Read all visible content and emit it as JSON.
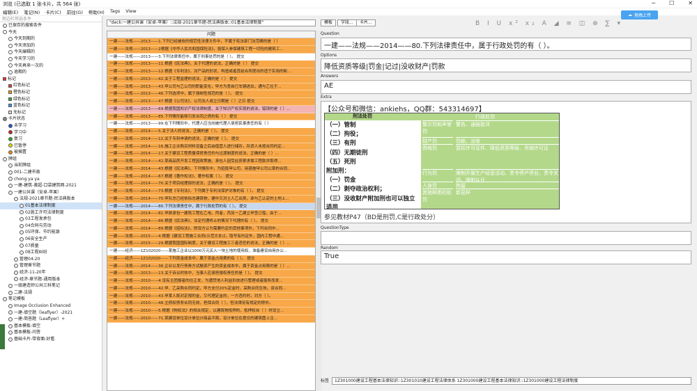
{
  "window": {
    "title": "浏览 (已选取 1 张卡片，共 564 张)",
    "controls": [
      "─",
      "☐",
      "✕"
    ]
  },
  "menu": [
    "编辑(E)",
    "笔记(N)",
    "卡片(C)",
    "前往(G)",
    "帮助(H)",
    "Tags",
    "View"
  ],
  "sync_label": "拖拽上传",
  "sidebar": {
    "search_placeholder": "侧边栏筛选条件",
    "items": [
      {
        "label": "已保存的搜索条件",
        "icon": "magnifier",
        "indent": 0
      },
      {
        "label": "今天",
        "icon": "clock",
        "indent": 0
      },
      {
        "label": "今天到期的",
        "icon": "clock",
        "indent": 1
      },
      {
        "label": "今天添加的",
        "icon": "clock",
        "indent": 1
      },
      {
        "label": "今天编辑的",
        "icon": "clock",
        "indent": 1
      },
      {
        "label": "今天学习的",
        "icon": "clock",
        "indent": 1
      },
      {
        "label": "今天再来一次的",
        "icon": "clock",
        "indent": 1
      },
      {
        "label": "逾期的",
        "icon": "clock",
        "indent": 1
      },
      {
        "label": "标记",
        "icon": "flag-red",
        "indent": 0
      },
      {
        "label": "红色标记",
        "icon": "flag-red",
        "indent": 1
      },
      {
        "label": "橙色标记",
        "icon": "flag-orange",
        "indent": 1
      },
      {
        "label": "绿色标记",
        "icon": "flag-green",
        "indent": 1
      },
      {
        "label": "蓝色标记",
        "icon": "flag-blue",
        "indent": 1
      },
      {
        "label": "无标记",
        "icon": "flag-white",
        "indent": 1
      },
      {
        "label": "卡片状态",
        "icon": "dot-grey",
        "indent": 0
      },
      {
        "label": "未学习",
        "icon": "dot-blue",
        "indent": 1
      },
      {
        "label": "学习中",
        "icon": "dot-red",
        "indent": 1
      },
      {
        "label": "复习",
        "icon": "dot-green",
        "indent": 1
      },
      {
        "label": "已暂停",
        "icon": "dot-yellow",
        "indent": 1
      },
      {
        "label": "被搁置",
        "icon": "dot-orange",
        "indent": 1
      },
      {
        "label": "牌组",
        "icon": "deck",
        "indent": 0
      },
      {
        "label": "当前牌组",
        "icon": "deck",
        "indent": 1
      },
      {
        "label": "001-二建市政",
        "icon": "deck",
        "indent": 1
      },
      {
        "label": "chong ya ya",
        "icon": "deck",
        "indent": 1
      },
      {
        "label": "一建-建筑-黄超-口袋建筑网-2021",
        "icon": "deck",
        "indent": 1
      },
      {
        "label": "一建公共课（安卓-苹果）",
        "icon": "deck",
        "indent": 1
      },
      {
        "label": "法规-2021章节题-民法典版本",
        "icon": "deck",
        "indent": 2
      },
      {
        "label": "01基本法律制度",
        "icon": "deck",
        "indent": 3,
        "selected": true
      },
      {
        "label": "02施工许可法律制度",
        "icon": "deck",
        "indent": 3
      },
      {
        "label": "03工程发承包",
        "icon": "deck",
        "indent": 3
      },
      {
        "label": "04合同与劳动",
        "icon": "deck",
        "indent": 3
      },
      {
        "label": "05环保、节约能源",
        "icon": "deck",
        "indent": 3
      },
      {
        "label": "06安全生产",
        "icon": "deck",
        "indent": 3
      },
      {
        "label": "07质量",
        "icon": "deck",
        "indent": 3
      },
      {
        "label": "08工程纠纷",
        "icon": "deck",
        "indent": 3
      },
      {
        "label": "管理04-20",
        "icon": "deck",
        "indent": 2
      },
      {
        "label": "管理章节题",
        "icon": "deck",
        "indent": 2
      },
      {
        "label": "经济-11-20年",
        "icon": "deck",
        "indent": 2
      },
      {
        "label": "经济-章节题-通用版本",
        "icon": "deck",
        "indent": 2
      },
      {
        "label": "一级建造师公共三科笔记",
        "icon": "deck",
        "indent": 1
      },
      {
        "label": "二建-法规",
        "icon": "deck",
        "indent": 1
      },
      {
        "label": "笔记模板",
        "icon": "note",
        "indent": 0
      },
      {
        "label": "Image Occlusion Enhanced",
        "icon": "note",
        "indent": 1
      },
      {
        "label": "一建-填空题（leaflyer）-2021",
        "icon": "note",
        "indent": 1
      },
      {
        "label": "一建-简答题（Leaflyer）+",
        "icon": "note",
        "indent": 1
      },
      {
        "label": "基本模板-填空",
        "icon": "note",
        "indent": 1
      },
      {
        "label": "基本模板-问答",
        "icon": "note",
        "indent": 1
      },
      {
        "label": "基础卡片-带背面-好看",
        "icon": "note",
        "indent": 1
      }
    ]
  },
  "search_value": "\"deck:一建公共课（安卓-苹果）::法规-2021章节题-民法典版本::01基本法律制度\"",
  "list": {
    "header": "问题",
    "rows": [
      {
        "t": "一建——法规——2013——1.下列已经被依的规范性法律文件中，不属于宪法部门法范畴的是（  ）",
        "c": "orange"
      },
      {
        "t": "一建——法规——2013——2根据《中华人民共和国保险法》，投保人参保建筑工程一切险的建筑工...",
        "c": "orange"
      },
      {
        "t": "一建——法规——2013——3.下列法律责任中，属于刑事处罚的是（  ）。          提交",
        "c": "white"
      },
      {
        "t": "一建——法规——2013——11.根据《民法典》，关于代理的说法，正确的是（  ）         提交",
        "c": "orange"
      },
      {
        "t": "一建——法规——2013——12.根据《专利法》，对产品的形状、构造或者其结合所提出的适于实用的新...",
        "c": "orange"
      },
      {
        "t": "一建——法规——2013——42.关于工程监理的说法，正确的是（  ）          提交",
        "c": "orange"
      },
      {
        "t": "一建——法规——2013——43.甲公司与乙公司的职能变化，甲方为意自已车辆进出，通与乙位于...",
        "c": "orange"
      },
      {
        "t": "一建——法规——2013——46.下列选项中，属于强制性规范的是（  ）。          提交",
        "c": "orange"
      },
      {
        "t": "一建——法规——2013——47.根据《公司法》，公司法人成立日期是（  ）之日         提交",
        "c": "orange"
      },
      {
        "t": "一建——法规——2013——69.根据我国知识产权法律制度，关于知识产权实现的说法，错误的是（  ）...",
        "c": "pink"
      },
      {
        "t": "一建——法规——2013——85.下列情形能够引发合同之债的有（  ）          提交",
        "c": "orange"
      },
      {
        "t": "一建——法规——2013——99.在下列情形中，代理人应当向被代理人承担民事责任的有（  ）",
        "c": "white"
      },
      {
        "t": "一建——法规——2014——5.关于法人的说法，正确的是（  ）。           提交",
        "c": "orange"
      },
      {
        "t": "一建——法规——2014——12.关于专利申请的说法，正确的是（  ）。         提交",
        "c": "orange"
      },
      {
        "t": "一建——法规——2014——16.施工企业购买材料设备之后由借营人进行储存，存货人未按合同约定...",
        "c": "orange"
      },
      {
        "t": "一建——法规——2014——17.关于建设工程质量保修责任的与过渡制度的说法，正确的是（  ）...",
        "c": "orange"
      },
      {
        "t": "一建——法规——2014——42.某商品房开发工程因政策施，承包人因受此获索求偿工程款并取得...",
        "c": "orange"
      },
      {
        "t": "一建——法规——2014——43.根据《民法典》，下列情形中，为招投甲公司，用甚施甲公司公章的合同...",
        "c": "orange"
      },
      {
        "t": "一建——法规——2014——67.根据《著作权法》，著作权属（  ）。          提交",
        "c": "orange"
      },
      {
        "t": "一建——法规——2014——70.关于项目经理部的说法，正确的是（  ）。          提交",
        "c": "orange"
      },
      {
        "t": "一建——法规——2014——73.根据《专利法》，下列属于专利法保护对象的有（  ）。         提交",
        "c": "orange"
      },
      {
        "t": "一建——法规——2014——75.甲队总已经依标志建筑物，建中又对土人乙出卖，承与乙认定的土地上...",
        "c": "orange"
      },
      {
        "t": "一建——法规——2014——80.下列法律责任中，属于行政处罚的有（  ）。        提交",
        "c": "sel"
      },
      {
        "t": "一建——法规——2014——81.甲欲承包一建筑工程在乙电，丙者，丙另一乙建立甲签订借，由于...",
        "c": "orange"
      },
      {
        "t": "一建——法规——2014——86.根据《民法典》，法定代理终止的情况下代理的有（  ）。         提交",
        "c": "orange"
      },
      {
        "t": "一建——法规——2014——89.根据《招标法》，除双方认为需要约定的其他事项外，下列合同中...",
        "c": "orange"
      },
      {
        "t": "一建——法规——2015——4.根据《建设工程施工合同(示范文本)》，隐号有约定外，国内工程中通...",
        "c": "orange"
      },
      {
        "t": "一建——法规——2015——29.根据我国国际制度，关于建设工程施工三者违任的说法，正确的是（  ）...",
        "c": "orange"
      },
      {
        "t": "一建——经济——1Z102020——某施工企业以1000万元买入一块土地的使用权，准备建设自用办公...",
        "c": "white"
      },
      {
        "t": "一建——经济——1Z102020——下列资金成本中，属于资金占用费的有（  ）。         提交",
        "c": "orange"
      },
      {
        "t": "一建——法规——2014——36.企业以发行债券方式融资产生的资金成本中，属于资金占用费的是（  ）...",
        "c": "orange"
      },
      {
        "t": "一建——法规——2013——13.关于诉讼时效中，当事人应承担侵权责任的是（  ）。        提交",
        "c": "orange"
      },
      {
        "t": "一建——法规——2010——4.没有主团报者的往正发，为遭焚他人利益形放进行管理或者服务而发...",
        "c": "orange"
      },
      {
        "t": "一建——法规——2010——42.甲、乙采购合同约定，甲方支付20%定金时，采购合同生效。该合同...",
        "c": "orange"
      },
      {
        "t": "一建——法规——2010——43.甲某人既对定规的金，又代理定金的，一方违约时，对方（  ）。",
        "c": "orange"
      },
      {
        "t": "一建——法规——2010——48.主债权债务合同无效，担保合同（  ），但法律另有规定的除外。",
        "c": "orange"
      },
      {
        "t": "一建——法规——2010——5.根据《物权法》的相关规定，以建筑物抵押的，抵押权自（  ）时设立...",
        "c": "orange"
      },
      {
        "t": "一建——法规——2010——71.某建设单位设计单位计商品平面，设计单位在提交的建筑图上注...",
        "c": "orange"
      }
    ]
  },
  "editor": {
    "buttons": [
      "字段...",
      "卡片..."
    ],
    "button0": "模板",
    "fmt_icons": "B I U x² x₂ A ◢ ≡ ◫ ⊕ ∑ ▾",
    "fields": {
      "question_label": "Question",
      "question": "一建——法规——2014——80.下列法律责任中，属于行政处罚的有（  ）。",
      "options_label": "Options",
      "options": "降低资质等级|罚金|记过|没收财产|罚款",
      "answers_label": "Answers",
      "answers": "AE",
      "extra_label": "Extra",
      "extra_header": "【公众号和微信：ankiehs，QQ群：543314697】",
      "extra_note": "参见教材P47（BD是刑罚,C是行政处分）",
      "questiontype_label": "QuestionType",
      "questiontype": "",
      "random_label": "Random",
      "random": "True",
      "tags_label": "标签",
      "tags": "1Z301000建设工程基本法律知识::1Z301010建设工程法律体系 1Z301000建设工程基本法律知识::1Z301000建设工程法律制度"
    },
    "table": {
      "col1_title": "刑法处罚",
      "col3_title": "行政处罚",
      "left_items": [
        "（一）管制",
        "（二）拘役；",
        "（三）有刑",
        "（四）无期徒刑",
        "（五）死刑",
        "附加刑：",
        "（一）罚金",
        "（二）剥夺政治权利；",
        "（三）没收财产附加刑也可以独立适用"
      ],
      "mid_items": [
        "警示罚和声誉罚",
        "财产罚",
        "资格罚",
        "行为罚",
        "人身罚",
        "其他种类的处罚"
      ],
      "right_items": [
        "警告、通报批评",
        "罚款、没收",
        "暂扣许可证件、降低资质等级、吊销许可证",
        "限制开展生产经营活动、责令停产停业、责令关闭、限制从业",
        "拘留",
        "新茄样"
      ]
    }
  }
}
